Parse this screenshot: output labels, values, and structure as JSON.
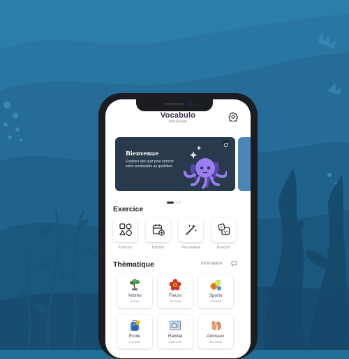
{
  "app": {
    "title": "Vocabulo",
    "subtitle": "Bienvenue",
    "settings_icon": "gear-icon"
  },
  "banner": {
    "title": "Bienvenue",
    "text": "Explorez des quiz pour enrichir votre vocabulaire au quotidien.",
    "illustration": "octopus-icon",
    "colors": {
      "background": "#2a3a4d",
      "accent": "#8a6bd8"
    },
    "carousel": {
      "count": 3,
      "active": 1
    }
  },
  "exercise": {
    "title": "Exercice",
    "items": [
      {
        "label": "Exercice",
        "icon": "shapes-icon"
      },
      {
        "label": "Hybride",
        "icon": "calendar-plus-icon"
      },
      {
        "label": "Personalisé",
        "icon": "magic-wand-icon"
      },
      {
        "label": "Random",
        "icon": "dice-icon"
      }
    ]
  },
  "thematic": {
    "title": "Thèmatique",
    "info_label": "Information",
    "items": [
      {
        "name": "Arbres",
        "count": "9 mots",
        "icon": "bonsai-tree-icon"
      },
      {
        "name": "Fleurs",
        "count": "26 mots",
        "icon": "red-flower-icon"
      },
      {
        "name": "Sports",
        "count": "74 mots",
        "icon": "sports-balls-icon"
      },
      {
        "name": "École",
        "count": "44 mots",
        "icon": "school-bag-icon"
      },
      {
        "name": "Habitat",
        "count": "138 mots",
        "icon": "house-plan-icon"
      },
      {
        "name": "Animaux",
        "count": "211 mots",
        "icon": "squirrel-icon"
      }
    ]
  }
}
